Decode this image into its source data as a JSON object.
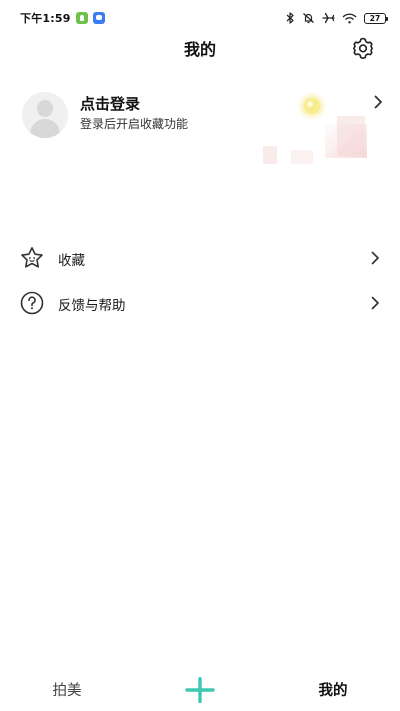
{
  "status_bar": {
    "time": "下午1:59",
    "battery": "27"
  },
  "header": {
    "title": "我的"
  },
  "profile": {
    "title": "点击登录",
    "subtitle": "登录后开启收藏功能"
  },
  "menu": [
    {
      "label": "收藏",
      "icon": "star-icon"
    },
    {
      "label": "反馈与帮助",
      "icon": "help-circle-icon"
    }
  ],
  "bottom_nav": {
    "tabs": [
      {
        "label": "拍美",
        "active": false
      },
      {
        "label": "我的",
        "active": true
      }
    ],
    "add_icon": "plus-icon"
  },
  "colors": {
    "accent": "#3ec9b5",
    "text": "#1a1a1a",
    "muted": "#8a8a8a",
    "background": "#ffffff"
  }
}
